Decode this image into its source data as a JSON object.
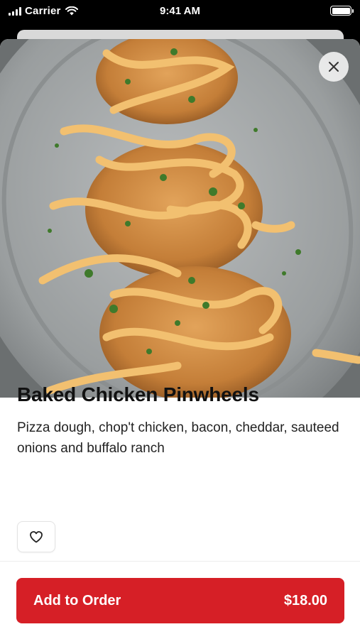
{
  "status_bar": {
    "carrier": "Carrier",
    "time": "9:41 AM",
    "icons": [
      "signal-icon",
      "wifi-icon",
      "battery-icon"
    ]
  },
  "hero": {
    "image": "photo-of-baked-chicken-pinwheels",
    "close_icon": "close-icon"
  },
  "item": {
    "title": "Baked Chicken Pinwheels",
    "description": "Pizza dough, chop't chicken, bacon, cheddar, sauteed onions and buffalo ranch"
  },
  "favorite": {
    "icon": "heart-icon"
  },
  "footer": {
    "add_label": "Add to Order",
    "price": "$18.00"
  },
  "colors": {
    "accent": "#d61f26",
    "text": "#111111"
  }
}
